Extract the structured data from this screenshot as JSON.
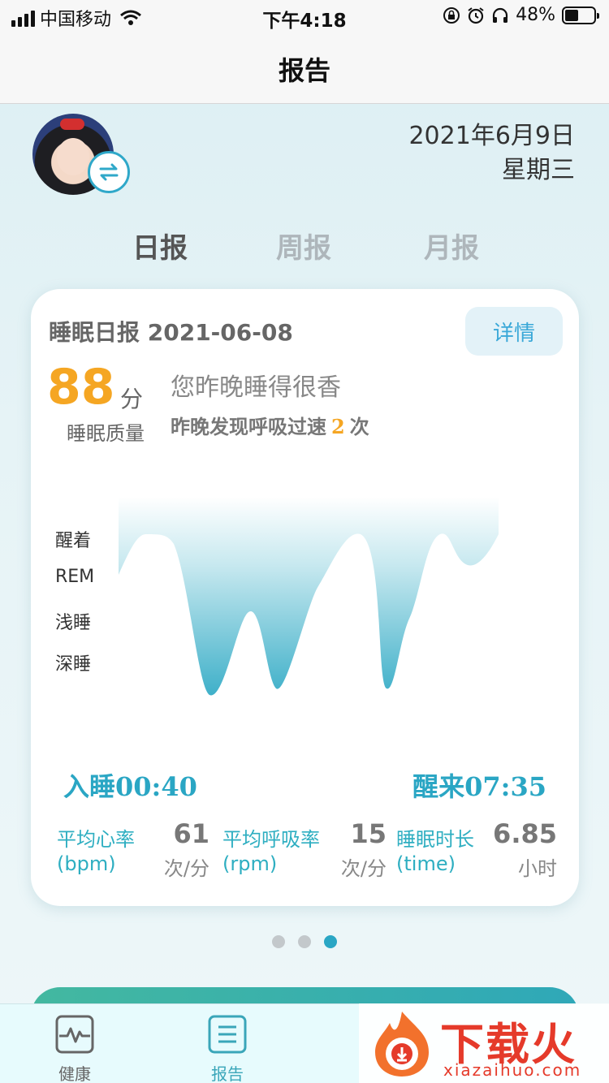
{
  "status_bar": {
    "carrier": "中国移动",
    "time": "下午4:18",
    "battery": "48%",
    "battery_level": 0.48
  },
  "nav": {
    "title": "报告"
  },
  "header": {
    "date": "2021年6月9日",
    "weekday": "星期三"
  },
  "tabs": [
    {
      "label": "日报",
      "active": true
    },
    {
      "label": "周报",
      "active": false
    },
    {
      "label": "月报",
      "active": false
    }
  ],
  "card": {
    "title": "睡眠日报 2021-06-08",
    "detail_button": "详情",
    "score": "88",
    "score_unit": "分",
    "score_label": "睡眠质量",
    "headline": "您昨晚睡得很香",
    "breath_prefix": "昨晚发现呼吸过速",
    "breath_count": "2",
    "breath_suffix": "次",
    "stages": [
      "醒着",
      "REM",
      "浅睡",
      "深睡"
    ],
    "sleep_start": "入睡00:40",
    "wake_time": "醒来07:35",
    "metrics": [
      {
        "label": "平均心率",
        "unit_en": "(bpm)",
        "value": "61",
        "unit": "次/分"
      },
      {
        "label": "平均呼吸率",
        "unit_en": "(rpm)",
        "value": "15",
        "unit": "次/分"
      },
      {
        "label": "睡眠时长",
        "unit_en": "(time)",
        "value": "6.85",
        "unit": "小时"
      }
    ]
  },
  "pager": {
    "count": 3,
    "active_index": 2
  },
  "tab_bar": {
    "items": [
      {
        "label": "健康",
        "icon": "heartbeat-icon"
      },
      {
        "label": "报告",
        "icon": "report-icon",
        "active": true
      }
    ]
  },
  "watermark": {
    "text": "下载火",
    "url": "xiazaihuo.com"
  },
  "colors": {
    "accent": "#2aa6c4",
    "score": "#f5a623",
    "metric": "#2eaec1"
  }
}
